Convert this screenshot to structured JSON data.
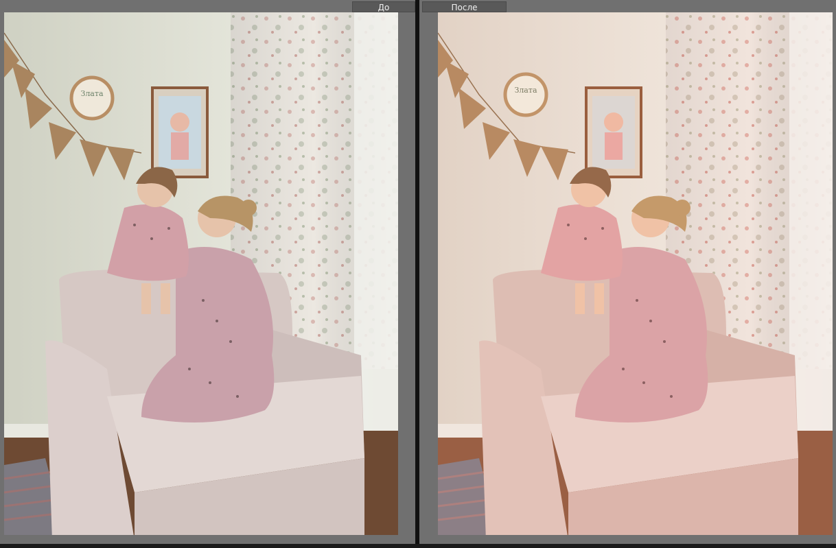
{
  "compare_view": {
    "before_label": "До",
    "after_label": "После"
  },
  "photo": {
    "embroidery_hoop_text": "Злата"
  },
  "colors": {
    "background": "#707070",
    "label_background": "#595959",
    "divider": "#111111",
    "before_wall": "#dfe0d4",
    "after_wall": "#ece1d7",
    "sofa_before": "#dccfcc",
    "sofa_after": "#e3c2b8"
  },
  "icons": {
    "bunting": "bunting-flag-icon",
    "hoop": "embroidery-hoop-icon"
  }
}
